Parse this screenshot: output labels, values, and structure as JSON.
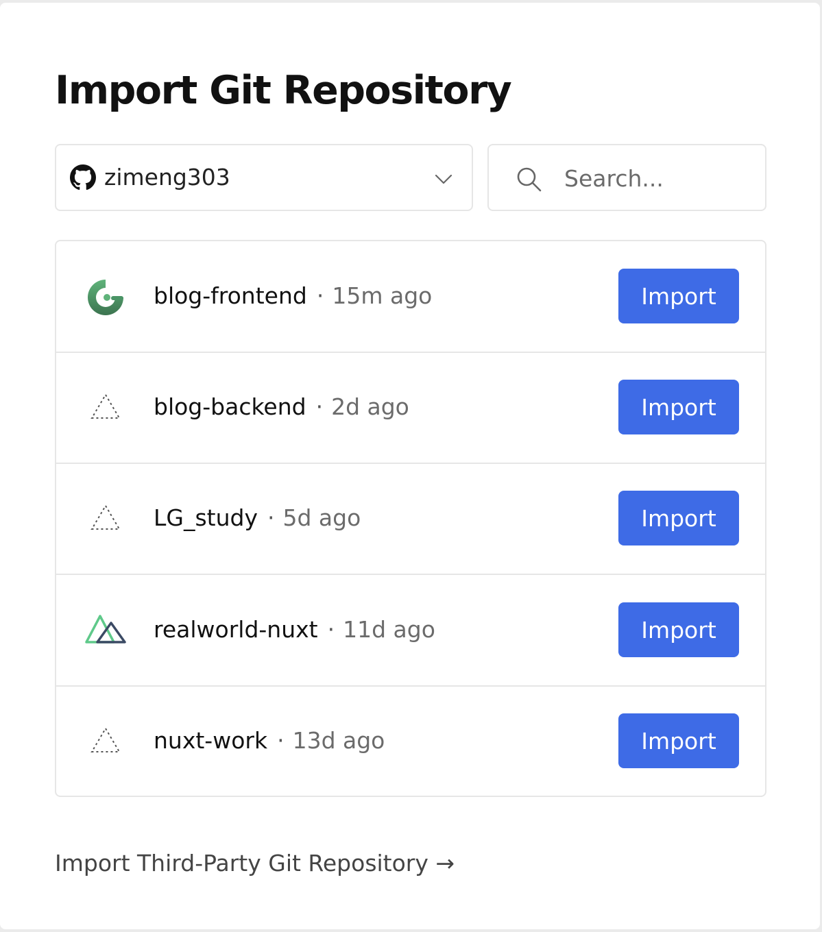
{
  "page": {
    "title": "Import Git Repository"
  },
  "scope": {
    "provider_icon": "github-icon",
    "account": "zimeng303",
    "dropdown_icon": "chevron-down-icon"
  },
  "search": {
    "icon": "search-icon",
    "placeholder": "Search...",
    "value": ""
  },
  "repos": [
    {
      "name": "blog-frontend",
      "separator": "·",
      "updated": "15m ago",
      "icon": "gridsome-icon",
      "action": "Import"
    },
    {
      "name": "blog-backend",
      "separator": "·",
      "updated": "2d ago",
      "icon": "generic-framework-triangle-icon",
      "action": "Import"
    },
    {
      "name": "LG_study",
      "separator": "·",
      "updated": "5d ago",
      "icon": "generic-framework-triangle-icon",
      "action": "Import"
    },
    {
      "name": "realworld-nuxt",
      "separator": "·",
      "updated": "11d ago",
      "icon": "nuxt-icon",
      "action": "Import"
    },
    {
      "name": "nuxt-work",
      "separator": "·",
      "updated": "13d ago",
      "icon": "generic-framework-triangle-icon",
      "action": "Import"
    }
  ],
  "footer": {
    "third_party_link": "Import Third-Party Git Repository →"
  },
  "colors": {
    "primary_button": "#3e6be6",
    "border": "#e6e6e6",
    "muted_text": "#6b6b6b"
  }
}
